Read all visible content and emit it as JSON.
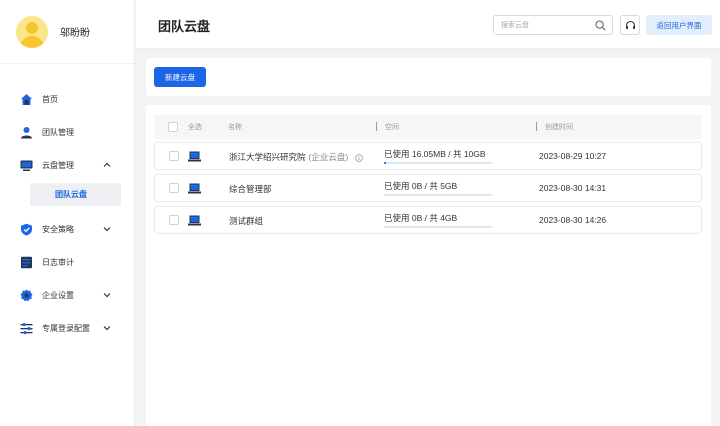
{
  "user": {
    "name": "邬盼盼"
  },
  "sidebar": {
    "items": [
      {
        "label": "首页"
      },
      {
        "label": "团队管理"
      },
      {
        "label": "云盘管理"
      },
      {
        "label": "安全策略"
      },
      {
        "label": "日志审计"
      },
      {
        "label": "企业设置"
      },
      {
        "label": "专属登录配置"
      }
    ],
    "sub_item": {
      "label": "团队云盘"
    }
  },
  "header": {
    "title": "团队云盘",
    "search_placeholder": "搜索云盘",
    "back_label": "返回用户界面"
  },
  "toolbar": {
    "new_label": "新建云盘"
  },
  "table": {
    "headers": {
      "select_all": "全选",
      "name": "名称",
      "space": "空间",
      "created": "创建时间"
    },
    "rows": [
      {
        "name": "浙江大学绍兴研究院",
        "tag": "(企业云盘)",
        "space": "已使用 16.05MB / 共 10GB",
        "usage": 0.0016,
        "created": "2023-08-29 10:27"
      },
      {
        "name": "综合管理部",
        "tag": "",
        "space": "已使用 0B / 共 5GB",
        "usage": 0,
        "created": "2023-08-30 14:31"
      },
      {
        "name": "测试群组",
        "tag": "",
        "space": "已使用 0B / 共 4GB",
        "usage": 0,
        "created": "2023-08-30 14:26"
      }
    ]
  },
  "colors": {
    "accent": "#1c66e5",
    "active_bg": "#eef0f4",
    "back_btn_bg": "#e3eefc"
  },
  "icons": {
    "nav": [
      "home-icon",
      "user-icon",
      "monitor-icon",
      "shield-icon",
      "log-icon",
      "settings-icon",
      "login-config-icon"
    ],
    "row": "disk-icon"
  }
}
